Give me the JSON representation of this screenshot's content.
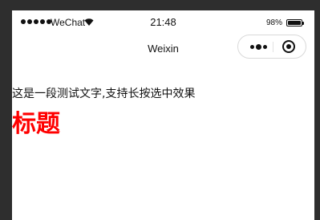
{
  "status_bar": {
    "carrier": "WeChat",
    "time": "21:48",
    "battery_percent": "98%",
    "battery_level": 0.98,
    "signal_icon": "signal-dots-icon",
    "wifi_icon": "wifi-icon",
    "battery_icon": "battery-icon"
  },
  "nav": {
    "title": "Weixin",
    "capsule": {
      "more_icon": "more-dots-icon",
      "close_icon": "target-close-icon"
    }
  },
  "content": {
    "text": "这是一段测试文字,支持长按选中效果",
    "title": "标题",
    "title_color": "#ff0000"
  }
}
